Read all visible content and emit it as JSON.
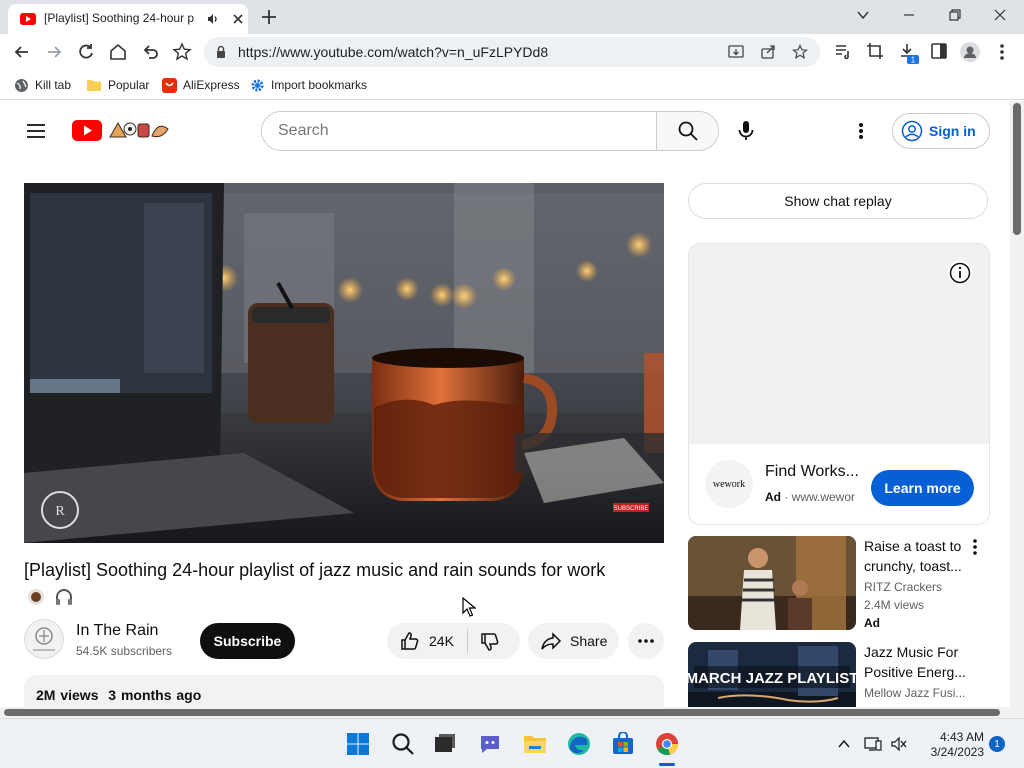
{
  "browser": {
    "tab": {
      "title": "[Playlist] Soothing 24-hour p",
      "favicon": "youtube-icon",
      "audio_icon": "speaker-icon"
    },
    "url": "https://www.youtube.com/watch?v=n_uFzLPYDd8",
    "bookmarks": [
      {
        "label": "Kill tab",
        "icon": "globe-icon"
      },
      {
        "label": "Popular",
        "icon": "folder-icon"
      },
      {
        "label": "AliExpress",
        "icon": "aliexpress-icon"
      },
      {
        "label": "Import bookmarks",
        "icon": "gear-icon"
      }
    ],
    "download_badge": "1"
  },
  "youtube": {
    "search_placeholder": "Search",
    "signin_label": "Sign in",
    "video": {
      "title": "[Playlist] Soothing 24-hour playlist of jazz music and rain sounds for work",
      "channel": "In The Rain",
      "subscribers": "54.5K subscribers",
      "subscribe_label": "Subscribe",
      "likes": "24K",
      "share_label": "Share",
      "views": "2M views",
      "age": "3 months ago",
      "watermark_label": "SUBSCRIBE"
    },
    "sidebar": {
      "chat_replay_label": "Show chat replay",
      "ad": {
        "title": "Find Works...",
        "ad_label": "Ad",
        "domain": "www.wewor",
        "logo_text": "wework",
        "cta": "Learn more"
      },
      "recommendations": [
        {
          "title": "Raise a toast to crunchy, toast...",
          "channel": "RITZ Crackers",
          "views": "2.4M views",
          "badge": "Ad"
        },
        {
          "title": "Jazz Music For Positive Energ...",
          "channel": "Mellow Jazz Fusi...",
          "thumb_text": "MARCH JAZZ PLAYLIST"
        }
      ]
    }
  },
  "taskbar": {
    "time": "4:43 AM",
    "date": "3/24/2023",
    "notification_count": "1"
  },
  "colors": {
    "youtube_red": "#ff0000",
    "link_blue": "#065fd4"
  }
}
